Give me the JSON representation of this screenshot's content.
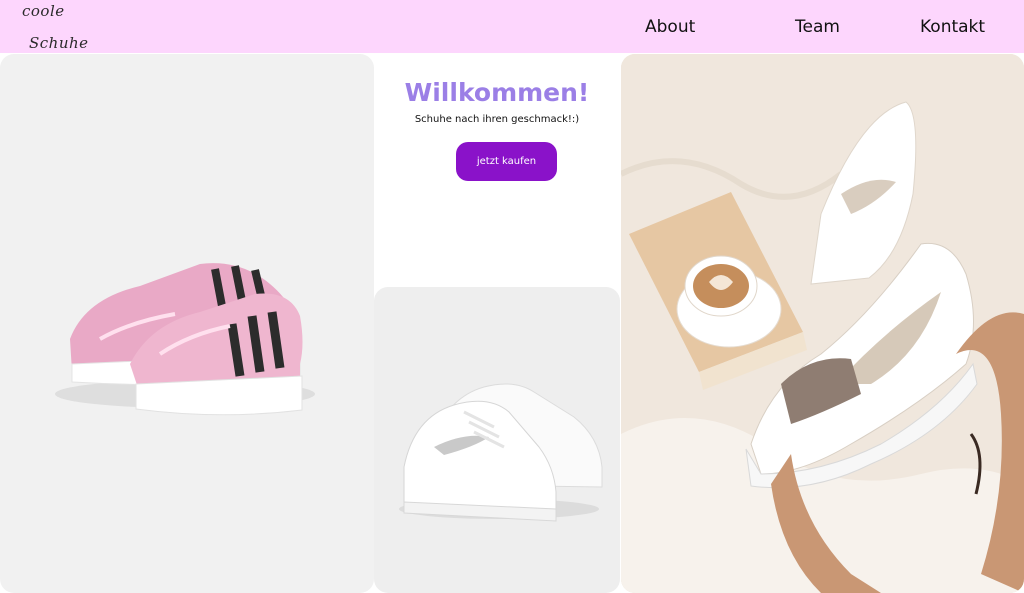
{
  "brand": {
    "line1": "coole",
    "line2": "Schuhe"
  },
  "nav": {
    "items": [
      "About",
      "Team",
      "Kontakt"
    ]
  },
  "hero": {
    "title": "Willkommen!",
    "subtitle": "Schuhe nach ihren geschmack!:)",
    "cta_label": "jetzt kaufen"
  },
  "colors": {
    "header_bg": "#fdd6fd",
    "accent_button": "#8a12c9",
    "title": "#9b7fe6"
  },
  "images": [
    {
      "name": "pink-sneakers-image"
    },
    {
      "name": "white-sneakers-image"
    },
    {
      "name": "beige-sneaker-lifestyle-image"
    }
  ]
}
